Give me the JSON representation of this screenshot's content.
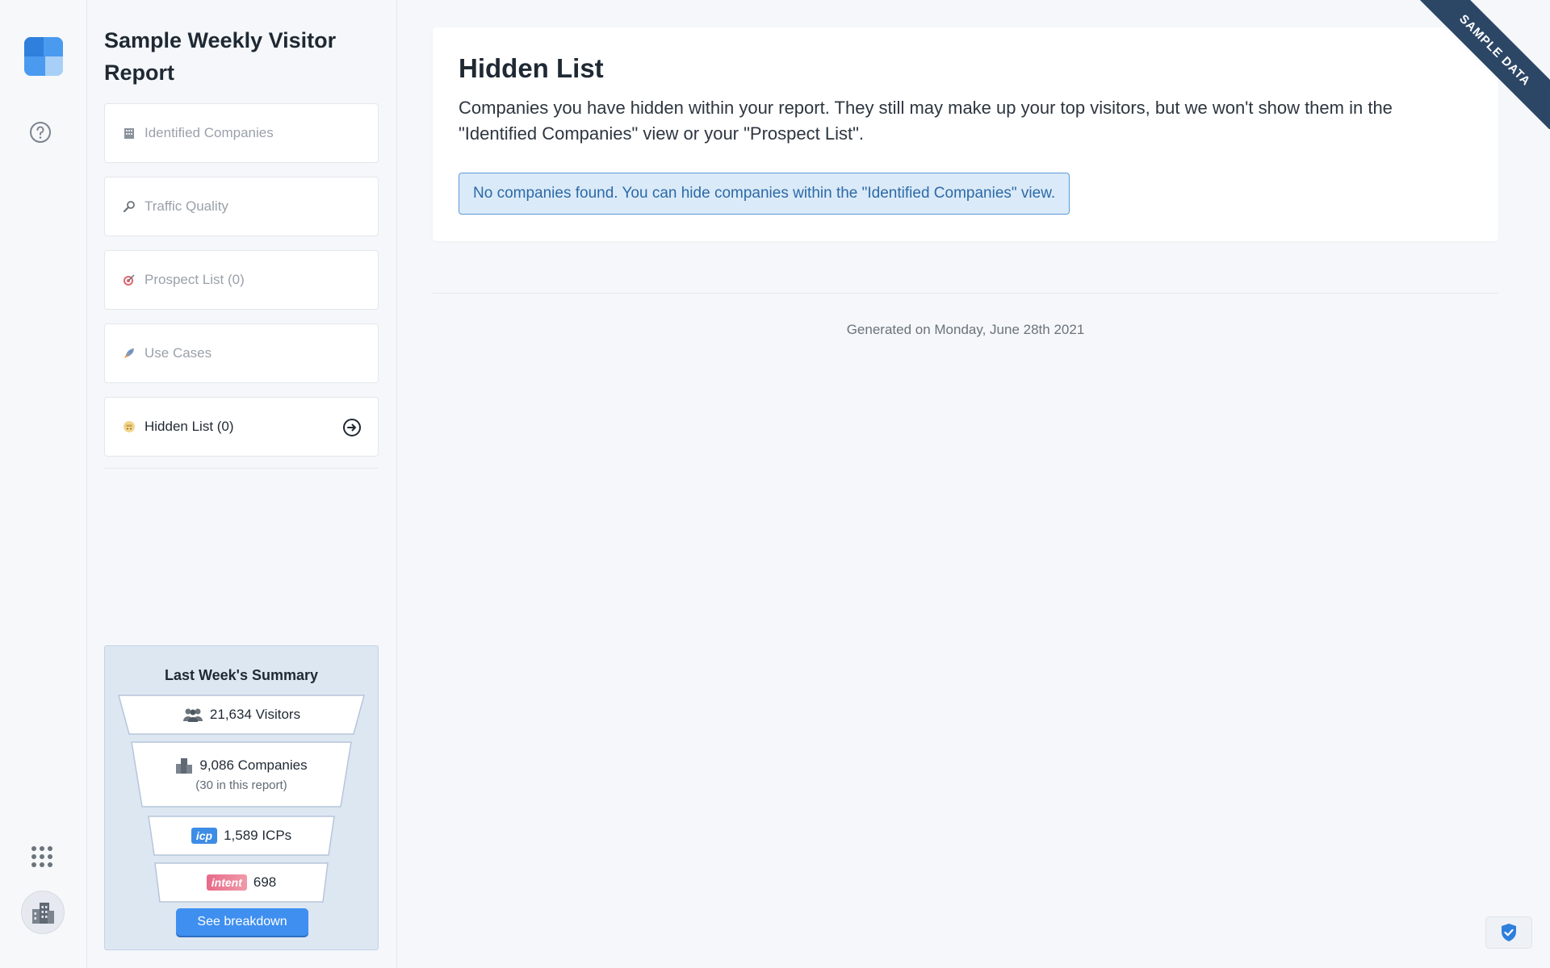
{
  "sidebar": {
    "report_title": "Sample Weekly Visitor Report",
    "items": [
      {
        "label": "Identified Companies",
        "icon": "building-icon"
      },
      {
        "label": "Traffic Quality",
        "icon": "magnifier-icon"
      },
      {
        "label": "Prospect List (0)",
        "icon": "target-icon"
      },
      {
        "label": "Use Cases",
        "icon": "rocket-icon"
      },
      {
        "label": "Hidden List (0)",
        "icon": "sneaky-face-icon",
        "active": true
      }
    ]
  },
  "summary": {
    "title": "Last Week's Summary",
    "visitors": "21,634 Visitors",
    "companies": "9,086 Companies",
    "companies_sub": "(30 in this report)",
    "icp_badge": "icp",
    "icps": "1,589 ICPs",
    "intent_badge": "intent",
    "intent_count": "698",
    "button_label": "See breakdown"
  },
  "main": {
    "title": "Hidden List",
    "description": "Companies you have hidden within your report. They still may make up your top visitors, but we won't show them in the \"Identified Companies\" view or your \"Prospect List\".",
    "alert": "No companies found. You can hide companies within the \"Identified Companies\" view.",
    "generated": "Generated on Monday, June 28th 2021"
  },
  "ribbon": "SAMPLE DATA",
  "colors": {
    "accent": "#3f8ff0",
    "ribbon": "#2c4666",
    "alert_bg": "#dbeaf8",
    "alert_border": "#5b9bd9",
    "intent": "#e86a8a"
  }
}
